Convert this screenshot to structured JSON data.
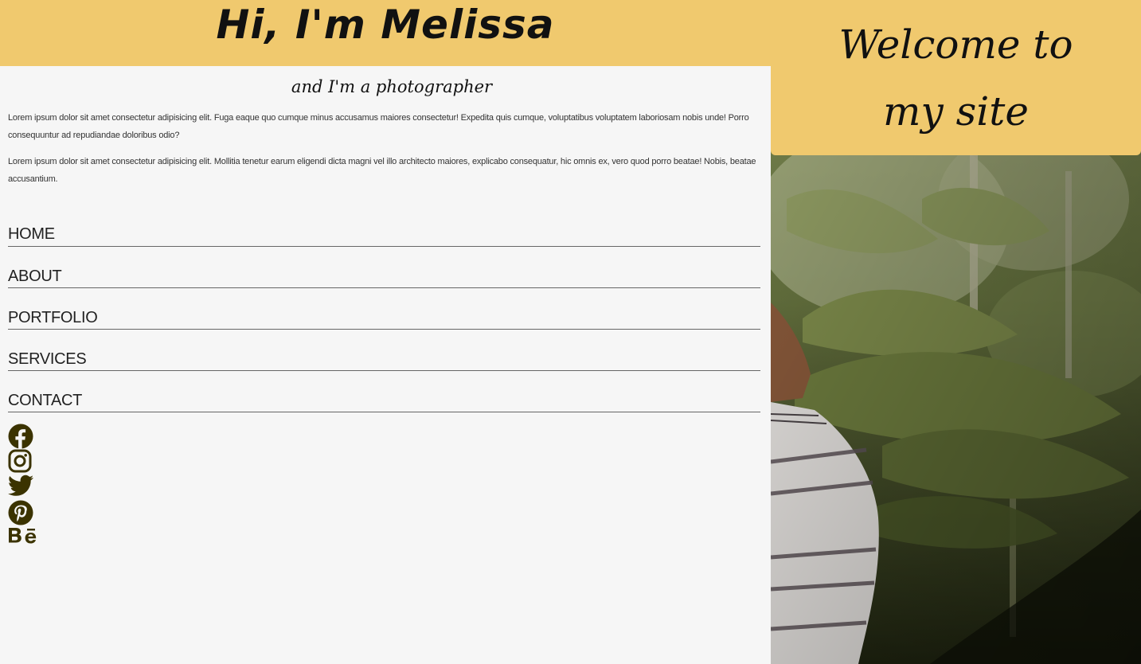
{
  "header": {
    "title": "Hi, I'm Melissa",
    "subtitle": "and I'm a photographer"
  },
  "intro": {
    "paragraphs": [
      "Lorem ipsum dolor sit amet consectetur adipisicing elit. Fuga eaque quo cumque minus accusamus maiores consectetur! Expedita quis cumque, voluptatibus voluptatem laboriosam nobis unde! Porro consequuntur ad repudiandae doloribus odio?",
      "Lorem ipsum dolor sit amet consectetur adipisicing elit. Mollitia tenetur earum eligendi dicta magni vel illo architecto maiores, explicabo consequatur, hic omnis ex, vero quod porro beatae! Nobis, beatae accusantium."
    ]
  },
  "nav": {
    "items": [
      {
        "label": "HOME"
      },
      {
        "label": "ABOUT"
      },
      {
        "label": "PORTFOLIO"
      },
      {
        "label": "SERVICES"
      },
      {
        "label": "CONTACT"
      }
    ]
  },
  "social": {
    "icons": [
      "facebook-icon",
      "instagram-icon",
      "twitter-icon",
      "pinterest-icon",
      "behance-icon"
    ],
    "color": "#3b3300"
  },
  "welcome": {
    "text": "Welcome to my site"
  },
  "colors": {
    "accent": "#f0c96e",
    "background": "#f6f6f6"
  }
}
